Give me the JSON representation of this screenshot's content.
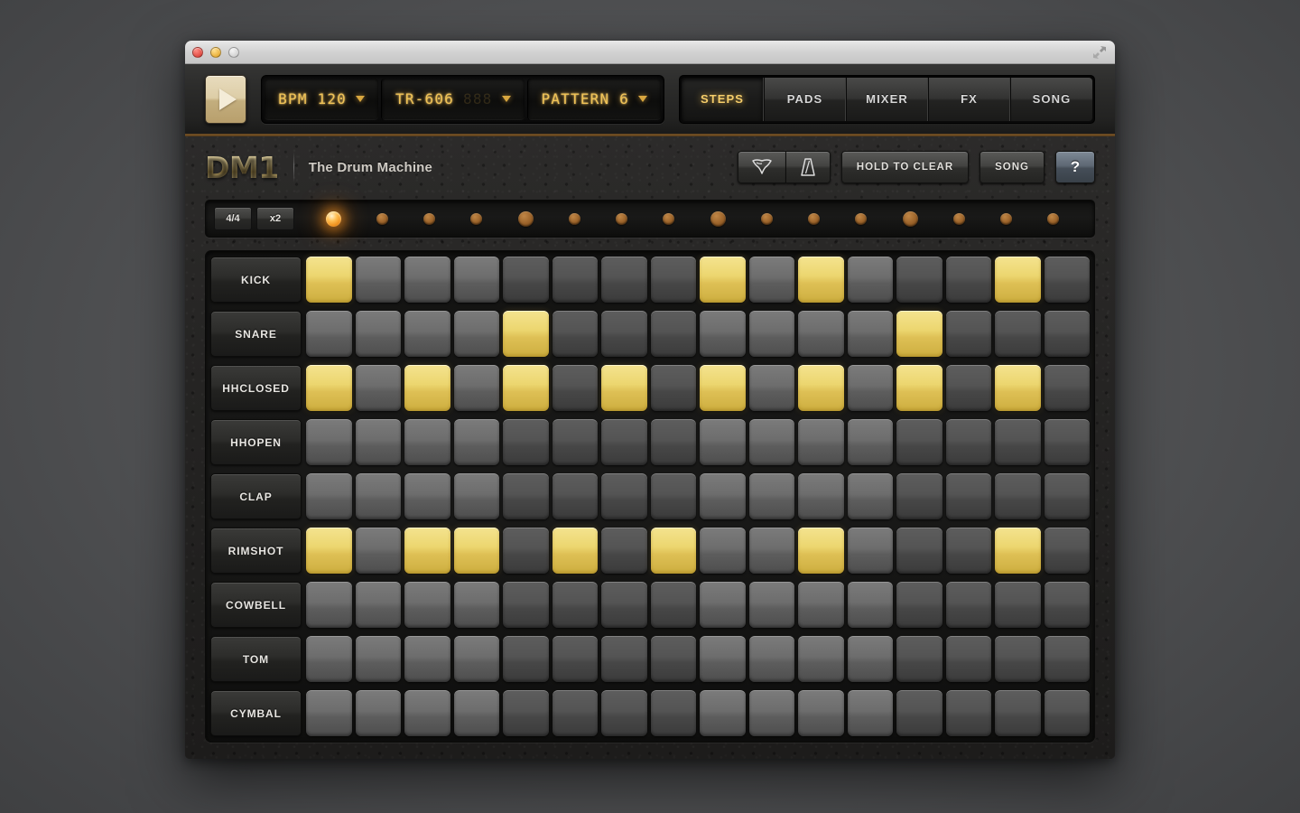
{
  "window": {
    "traffic_lights": [
      "close",
      "minimize",
      "zoom"
    ],
    "resize_icon": "resize-diagonal-icon"
  },
  "toolbar": {
    "play_label": "play",
    "displays": [
      {
        "id": "bpm",
        "text": "BPM 120",
        "ghost": "",
        "caret": "▼"
      },
      {
        "id": "kit",
        "text": "TR-606",
        "ghost": "888",
        "caret": "▼"
      },
      {
        "id": "pattern",
        "text": "PATTERN 6",
        "ghost": "",
        "caret": "▼"
      }
    ],
    "tabs": [
      {
        "label": "STEPS",
        "active": true
      },
      {
        "label": "PADS",
        "active": false
      },
      {
        "label": "MIXER",
        "active": false
      },
      {
        "label": "FX",
        "active": false
      },
      {
        "label": "SONG",
        "active": false
      }
    ]
  },
  "brand": {
    "logo": "DM1",
    "tagline": "The Drum Machine"
  },
  "brand_tools": {
    "shake_icon": "shake-randomize-icon",
    "metronome_icon": "metronome-icon",
    "hold_to_clear": "HOLD TO CLEAR",
    "song": "SONG",
    "help": "?"
  },
  "meter": {
    "signature": "4/4",
    "multiplier": "x2",
    "steps": 16,
    "current_step": 1,
    "beat_steps": [
      1,
      5,
      9,
      13
    ]
  },
  "colors": {
    "pad_active": "#ecd66f",
    "pad_inactive": "#6d6d6d",
    "lcd_text": "#f0c356",
    "led_on": "#ffbe52",
    "accent_gold": "#f5cd6a"
  },
  "sequencer": {
    "step_count": 16,
    "tracks": [
      {
        "name": "KICK",
        "steps": [
          1,
          0,
          0,
          0,
          0,
          0,
          0,
          0,
          1,
          0,
          1,
          0,
          0,
          0,
          1,
          0
        ]
      },
      {
        "name": "SNARE",
        "steps": [
          0,
          0,
          0,
          0,
          1,
          0,
          0,
          0,
          0,
          0,
          0,
          0,
          1,
          0,
          0,
          0
        ]
      },
      {
        "name": "HHCLOSED",
        "steps": [
          1,
          0,
          1,
          0,
          1,
          0,
          1,
          0,
          1,
          0,
          1,
          0,
          1,
          0,
          1,
          0
        ]
      },
      {
        "name": "HHOPEN",
        "steps": [
          0,
          0,
          0,
          0,
          0,
          0,
          0,
          0,
          0,
          0,
          0,
          0,
          0,
          0,
          0,
          0
        ]
      },
      {
        "name": "CLAP",
        "steps": [
          0,
          0,
          0,
          0,
          0,
          0,
          0,
          0,
          0,
          0,
          0,
          0,
          0,
          0,
          0,
          0
        ]
      },
      {
        "name": "RIMSHOT",
        "steps": [
          1,
          0,
          1,
          1,
          0,
          1,
          0,
          1,
          0,
          0,
          1,
          0,
          0,
          0,
          1,
          0
        ]
      },
      {
        "name": "COWBELL",
        "steps": [
          0,
          0,
          0,
          0,
          0,
          0,
          0,
          0,
          0,
          0,
          0,
          0,
          0,
          0,
          0,
          0
        ]
      },
      {
        "name": "TOM",
        "steps": [
          0,
          0,
          0,
          0,
          0,
          0,
          0,
          0,
          0,
          0,
          0,
          0,
          0,
          0,
          0,
          0
        ]
      },
      {
        "name": "CYMBAL",
        "steps": [
          0,
          0,
          0,
          0,
          0,
          0,
          0,
          0,
          0,
          0,
          0,
          0,
          0,
          0,
          0,
          0
        ]
      }
    ]
  }
}
